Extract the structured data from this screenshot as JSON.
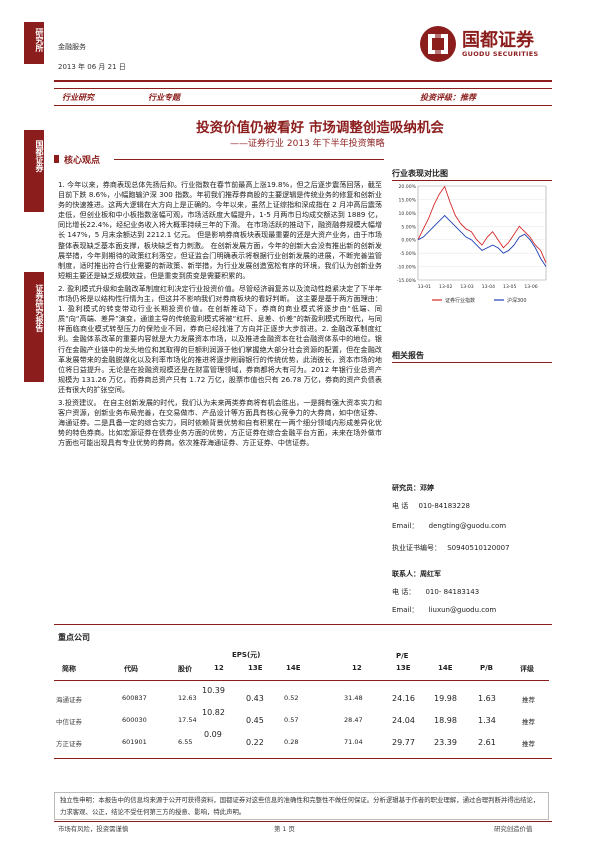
{
  "sidebar": {
    "top_label": "研究所",
    "mid_label": "国都证券",
    "bottom_label": "证券研究报告"
  },
  "header": {
    "department": "金融服务",
    "date": "2013 年 06 月 21 日",
    "logo_cn": "国都证券",
    "logo_en": "GUODU SECURITIES"
  },
  "tags": {
    "industry": "行业研究",
    "topic": "行业专题",
    "rating": "投资评级：推荐"
  },
  "title": {
    "main": "投资价值仍被看好  市场调整创造吸纳机会",
    "sub": "——证券行业 2013 年下半年投资策略"
  },
  "core_view": {
    "heading": "核心观点",
    "paragraphs": [
      "1. 今年以来，券商表现总体先扬后抑。行业指数在春节前最高上涨19.8%，但之后逐步震荡回落，截至目前下跌 8.6%，小幅跑输沪深 300 指数。年初我们推荐券商股的主要逻辑是传统业务的修复和创新业务的快速推进。这两大逻辑在大方向上是正确的。今年以来，虽然上证综指和深成指在 2 月冲高后震荡走低，但创业板和中小板指数涨幅可观，市场活跃度大幅提升，1-5 月两市日均成交额达到 1889 亿，同比增长22.4%，经纪业务收入将大概率持续三年的下滑。 在市场活跃的推动下，融资融券规模大幅增长 147%，5 月末余额达到 2212.1 亿元。 但是影响券商板块表现最重要的还是大资产业务，由于市场整体表现缺乏基本面支撑，板块缺乏有力刺激。 在创新发展方面，今年的创新大会没有推出新的创新发展举措，今年则期待的政策红利落空，但证监会门明确表示将根据行业创新发展的进展，不断完善监管制度，适时推出符合行业需要的新政策、新举措，为行业发展创造宽松有序的环境，我们认为创新业务短期主要还是缺乏规模效益，但是重变到质变是需要积累的。",
      "2. 盈利模式升级和金融改革制度红利决定行业投资价值。尽管经济弱复苏以及流动性趋紧决定了下半年市场仍将是以结构性行情为主，但这并不影响我们对券商板块的看好判断。 这主要是基于两方面理由：1. 盈利模式的转变带动行业长期投资价值。在创新推动下，券商的商业模式将逐步由“低端、同质”向“高端、差异”演变，通道主导的传统盈利模式将被“杠杆、息差、价差”的新盈利模式所取代，与同样面临商业模式转型压力的保险业不同，券商已经找准了方向并正逐步大步前进。2. 金融改革制度红利。金融体系改革的重要内容就是大力发展资本市场，以及推进金融资本在社会融资体系中的地位。银行在金融产业链中的龙头地位和其取得的巨额利润源于他们掌握绝大部分社会资源的配置，但在金融改革发展带来的金融脱媒化以及利率市场化的推进将逐步削弱银行的传统优势，此消彼长，资本市场的地位将日益提升。无论是在投融资规模还是在财富管理领域，券商都将大有可为。2012 年银行业总资产规模为 131.26 万亿，而券商总资产只有 1.72 万亿，股票市值也只有 26.78 万亿，券商的资产负债表还有很大的扩张空间。",
      "3.投资建议。 在自主创新发展的时代，我们认为未来两类券商将有机会胜出，一是拥有强大资本实力和客户资源，创新业务布局完善，在交易做市、产品设计等方面具有核心竞争力的大券商，如中信证券、海通证券。二是具备一定的综合实力，同时依赖背景优势和自有积累在一两个细分领域内形成差异化优势的特色券商。比如宏源证券在债券业务方面的优势，方正证券在综合金融平台方面，未来在场外做市方面也可能出现具有专业优势的券商。依次推荐海通证券、方正证券、中信证券。"
    ]
  },
  "chart_data": {
    "type": "line",
    "title": "行业表现对比图",
    "x_ticks": [
      "13-01",
      "13-02",
      "13-03",
      "13-04",
      "13-05",
      "13-06"
    ],
    "y_ticks": [
      "20.00%",
      "15.00%",
      "10.00%",
      "5.00%",
      "0.00%",
      "-5.00%",
      "-10.00%",
      "-15.00%"
    ],
    "ylim": [
      -15,
      20
    ],
    "legend_position": "bottom",
    "series": [
      {
        "name": "证券行业指数",
        "color": "#d62728",
        "values": [
          0,
          4,
          8,
          13,
          17,
          19.8,
          14,
          9,
          6,
          4,
          3,
          0,
          -2,
          1,
          3,
          0,
          -3,
          -1,
          2,
          5,
          3,
          1,
          -2,
          -4,
          -8.6
        ]
      },
      {
        "name": "沪深300",
        "color": "#1f3fb4",
        "values": [
          0,
          1,
          3,
          5,
          7,
          9,
          7,
          5,
          3,
          1,
          0,
          -2,
          -4,
          -3,
          -2,
          -3,
          -5,
          -4,
          -2,
          1,
          2,
          0,
          -3,
          -7,
          -10
        ]
      }
    ]
  },
  "related_reports": {
    "heading": "相关报告"
  },
  "analyst": {
    "researcher_label": "研究员：邓婷",
    "phone_label": "电    话",
    "phone": "010-84183228",
    "email_label": "Email：",
    "email": "dengting@guodu.com",
    "cert_label": "执业证书编号：",
    "cert": "S0940510120007",
    "contact_label": "联系人：周红军",
    "contact_phone_label": "电    话：",
    "contact_phone": "010- 84183143",
    "contact_email_label": "Email：",
    "contact_email": "liuxun@guodu.com"
  },
  "stocks": {
    "heading": "重点公司",
    "headers": {
      "name": "简称",
      "code": "代码",
      "price": "股价",
      "eps": "EPS(元)",
      "eps_12": "12",
      "eps_13": "13E",
      "eps_14": "14E",
      "pe": "P/E",
      "pe_12": "12",
      "pe_13": "13E",
      "pe_14": "14E",
      "pb": "P/B",
      "rating": "评级"
    },
    "rows": [
      {
        "name": "海通证券",
        "code": "600837",
        "price": "12.63",
        "eps12": "10.39",
        "eps13": "0.43",
        "eps14": "0.52",
        "pe12": "31.48",
        "pe13": "24.16",
        "pe14": "19.98",
        "pb": "1.63",
        "rating": "推荐"
      },
      {
        "name": "中信证券",
        "code": "600030",
        "price": "17.54",
        "eps12": "10.82",
        "eps13": "0.45",
        "eps14": "0.57",
        "pe12": "28.47",
        "pe13": "24.04",
        "pe14": "18.98",
        "pb": "1.34",
        "rating": "推荐"
      },
      {
        "name": "方正证券",
        "code": "601901",
        "price": "6.55",
        "eps12": "0.09",
        "eps13": "0.22",
        "eps14": "0.28",
        "pe12": "71.04",
        "pe13": "29.77",
        "pe14": "23.39",
        "pb": "2.61",
        "rating": "推荐"
      }
    ]
  },
  "disclaimer": "独立性申明：本报告中的信息均来源于公开可获得资料，国都证券对这些信息的准确性和完整性不做任何保证。分析逻辑基于作者的职业理解，通过合理判断并得出结论，力求客观、公正，结论不受任何第三方的授意、影响，特此声明。",
  "footer": {
    "left": "市场有风险，投资需谨慎",
    "center": "第 1 页",
    "right": "研究创造价值"
  }
}
